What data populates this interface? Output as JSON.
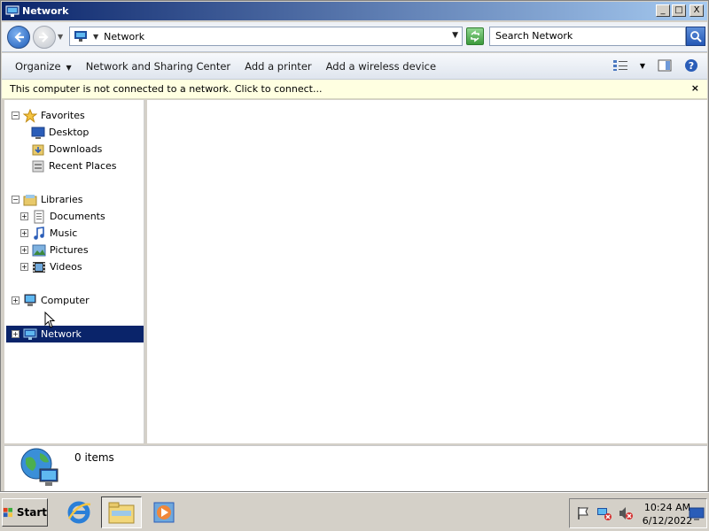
{
  "window": {
    "title": "Network",
    "controls": {
      "minimize": "_",
      "maximize": "□",
      "close": "X"
    }
  },
  "navigation": {
    "address_path": "Network",
    "search_placeholder": "Search Network"
  },
  "commands": {
    "organize": "Organize",
    "items": [
      "Network and Sharing Center",
      "Add a printer",
      "Add a wireless device"
    ]
  },
  "infobar": {
    "message": "This computer is not connected to a network. Click to connect...",
    "close": "×"
  },
  "tree": {
    "favorites": {
      "label": "Favorites",
      "children": [
        "Desktop",
        "Downloads",
        "Recent Places"
      ]
    },
    "libraries": {
      "label": "Libraries",
      "children": [
        "Documents",
        "Music",
        "Pictures",
        "Videos"
      ]
    },
    "computer": "Computer",
    "network": "Network"
  },
  "details": {
    "item_count": "0 items"
  },
  "taskbar": {
    "start_label": "Start",
    "clock_time": "10:24 AM",
    "clock_date": "6/12/2022"
  },
  "colors": {
    "selection": "#0a246a",
    "title_gradient_start": "#0a246a",
    "title_gradient_end": "#a6caf0",
    "infobar_bg": "#ffffe1"
  },
  "icons": {
    "title": "network-icon",
    "back": "back-arrow-icon",
    "forward": "forward-arrow-icon",
    "refresh": "refresh-icon",
    "search": "search-icon",
    "views": "views-icon",
    "preview": "preview-pane-icon",
    "help": "help-icon"
  }
}
